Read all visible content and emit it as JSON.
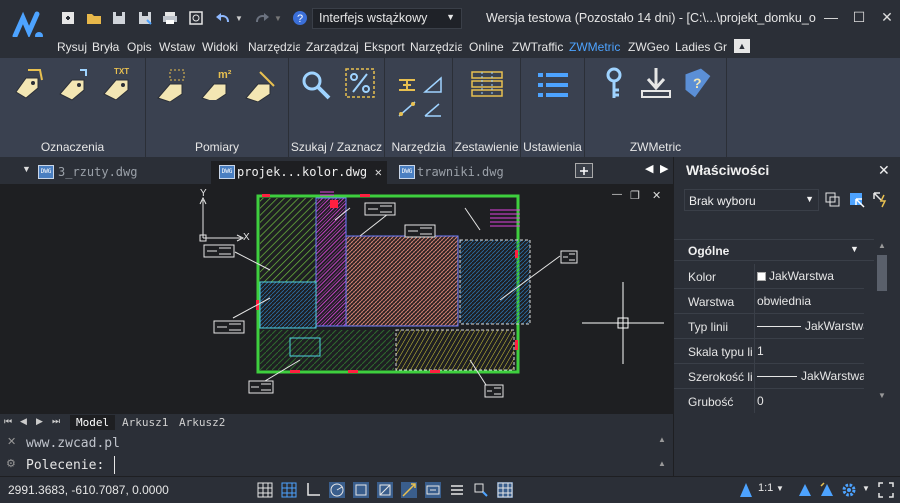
{
  "titlebar": {
    "workspace": "Interfejs wstążkowy",
    "title": "Wersja testowa (Pozostało 14 dni) - [C:\\...\\projekt_domku_obwie",
    "win_min": "—",
    "win_max": "☐",
    "win_close": "✕"
  },
  "menu": [
    "Rysuj",
    "Bryła",
    "Opis",
    "Wstaw",
    "Widoki",
    "Narzędzia",
    "Zarządzaj",
    "Eksport",
    "Narzędzia",
    "Online",
    "ZWTraffic",
    "ZWMetric",
    "ZWGeo",
    "Ladies Gr"
  ],
  "menu_active_index": 11,
  "menu_collapse": "▲",
  "ribbon": {
    "groups": [
      "Oznaczenia",
      "Pomiary",
      "Szukaj / Zaznacz",
      "Narzędzia",
      "Zestawienie",
      "Ustawienia",
      "ZWMetric"
    ]
  },
  "tabs": [
    {
      "label": "3_rzuty.dwg",
      "active": false
    },
    {
      "label": "projek...kolor.dwg",
      "active": true
    },
    {
      "label": "trawniki.dwg",
      "active": false
    }
  ],
  "tab_close": "✕",
  "tab_dropdown": "▼",
  "drawing": {
    "viewport_controls": [
      "—",
      "❐",
      "✕"
    ],
    "ucs_x": "X",
    "ucs_y": "Y"
  },
  "sheets": [
    "Model",
    "Arkusz1",
    "Arkusz2"
  ],
  "sheet_active": 0,
  "command": {
    "history": "www.zwcad.pl",
    "prompt": "Polecenie:",
    "value": ""
  },
  "properties": {
    "title": "Właściwości",
    "close": "✕",
    "selection": "Brak wyboru",
    "section": "Ogólne",
    "rows": [
      {
        "name": "Kolor",
        "value": "JakWarstwa"
      },
      {
        "name": "Warstwa",
        "value": "obwiednia"
      },
      {
        "name": "Typ linii",
        "value": "JakWarstwa"
      },
      {
        "name": "Skala typu linii",
        "value": "1"
      },
      {
        "name": "Szerokość linii",
        "value": "JakWarstwa"
      },
      {
        "name": "Grubość",
        "value": "0"
      }
    ]
  },
  "status": {
    "coords": "2991.3683, -610.7087, 0.0000",
    "scale": "1:1"
  },
  "colors": {
    "accent": "#4da3ff",
    "ribbon_bg": "#3a4150",
    "icon_cream": "#f3e6b3",
    "drawing_bg": "#1e1f22"
  }
}
